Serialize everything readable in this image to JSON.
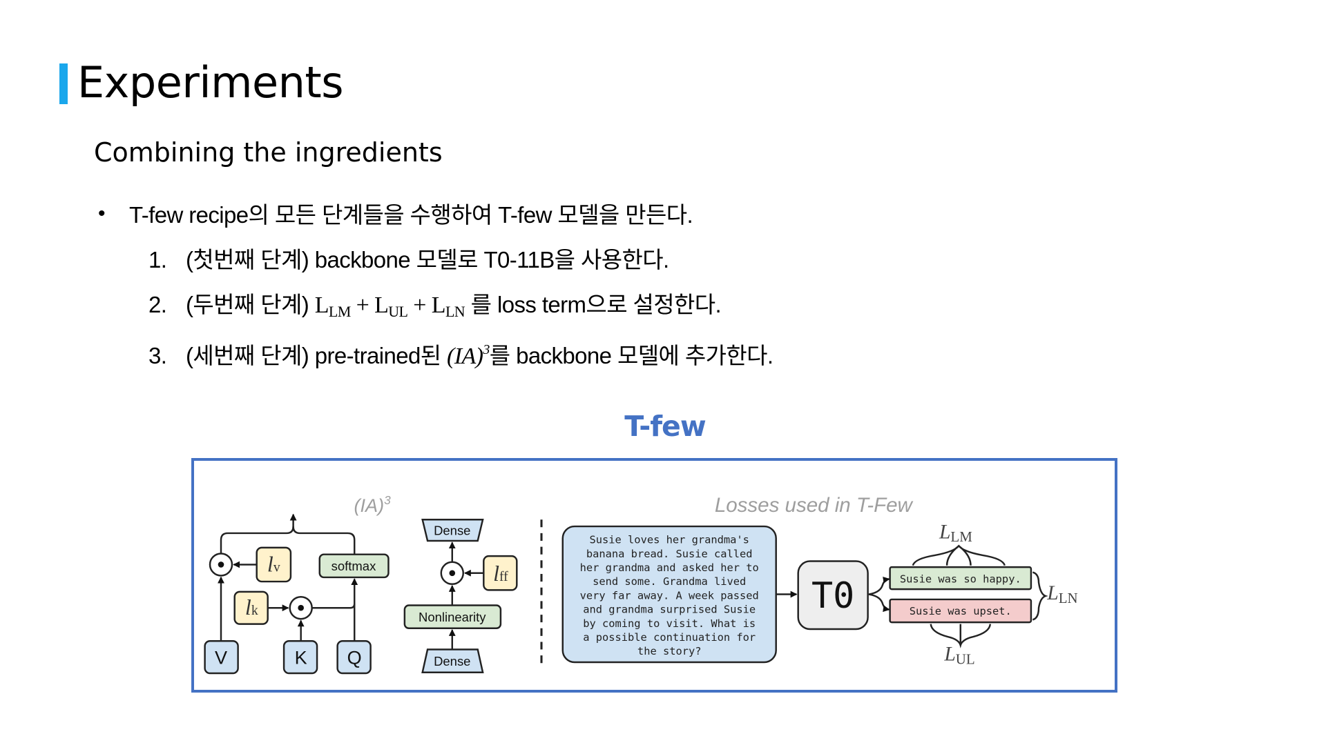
{
  "header": {
    "title": "Experiments",
    "subtitle": "Combining the ingredients"
  },
  "bullets": {
    "main": "T-few recipe의 모든 단계들을 수행하여 T-few 모델을 만든다.",
    "steps": [
      {
        "num": "1.",
        "text": "(첫번째 단계) backbone 모델로 T0-11B을 사용한다."
      },
      {
        "num": "2.",
        "prefix": "(두번째 단계) ",
        "L": "L",
        "sub1": "LM",
        "plus": " + ",
        "sub2": "UL",
        "sub3": "LN",
        "suffix": " 를 loss term으로 설정한다."
      },
      {
        "num": "3.",
        "prefix": "(세번째 단계) pre-trained된 ",
        "math": "(IA)",
        "sup": "3",
        "suffix": "를 backbone 모델에 추가한다."
      }
    ]
  },
  "figure": {
    "title": "T-few",
    "colors": {
      "accent": "#4472c4",
      "blue_box": "#cfe2f3",
      "yellow_box": "#fff2cc",
      "green_box": "#d9ead3",
      "red_box": "#f4cccc",
      "gray_label": "#9e9e9e"
    },
    "ia3_label": "(IA)",
    "ia3_sup": "3",
    "losses_label": "Losses used in T-Few",
    "attention": {
      "V": "V",
      "K": "K",
      "Q": "Q",
      "softmax": "softmax",
      "l": "l",
      "lv_sub": "v",
      "lk_sub": "k"
    },
    "ffn": {
      "dense_top": "Dense",
      "dense_bottom": "Dense",
      "nonlinearity": "Nonlinearity",
      "lff_sub": "ff"
    },
    "story_lines": [
      "Susie loves her grandma's",
      "banana bread. Susie called",
      "her grandma and asked her to",
      "send some. Grandma lived",
      "very far away. A week passed",
      "and grandma surprised Susie",
      "by coming to visit. What is",
      "a possible continuation for",
      "the story?"
    ],
    "model": "T0",
    "answer_good": "Susie was so happy.",
    "answer_bad": "Susie was upset.",
    "loss_L": "L",
    "loss_lm": "LM",
    "loss_ul": "UL",
    "loss_ln": "LN"
  }
}
